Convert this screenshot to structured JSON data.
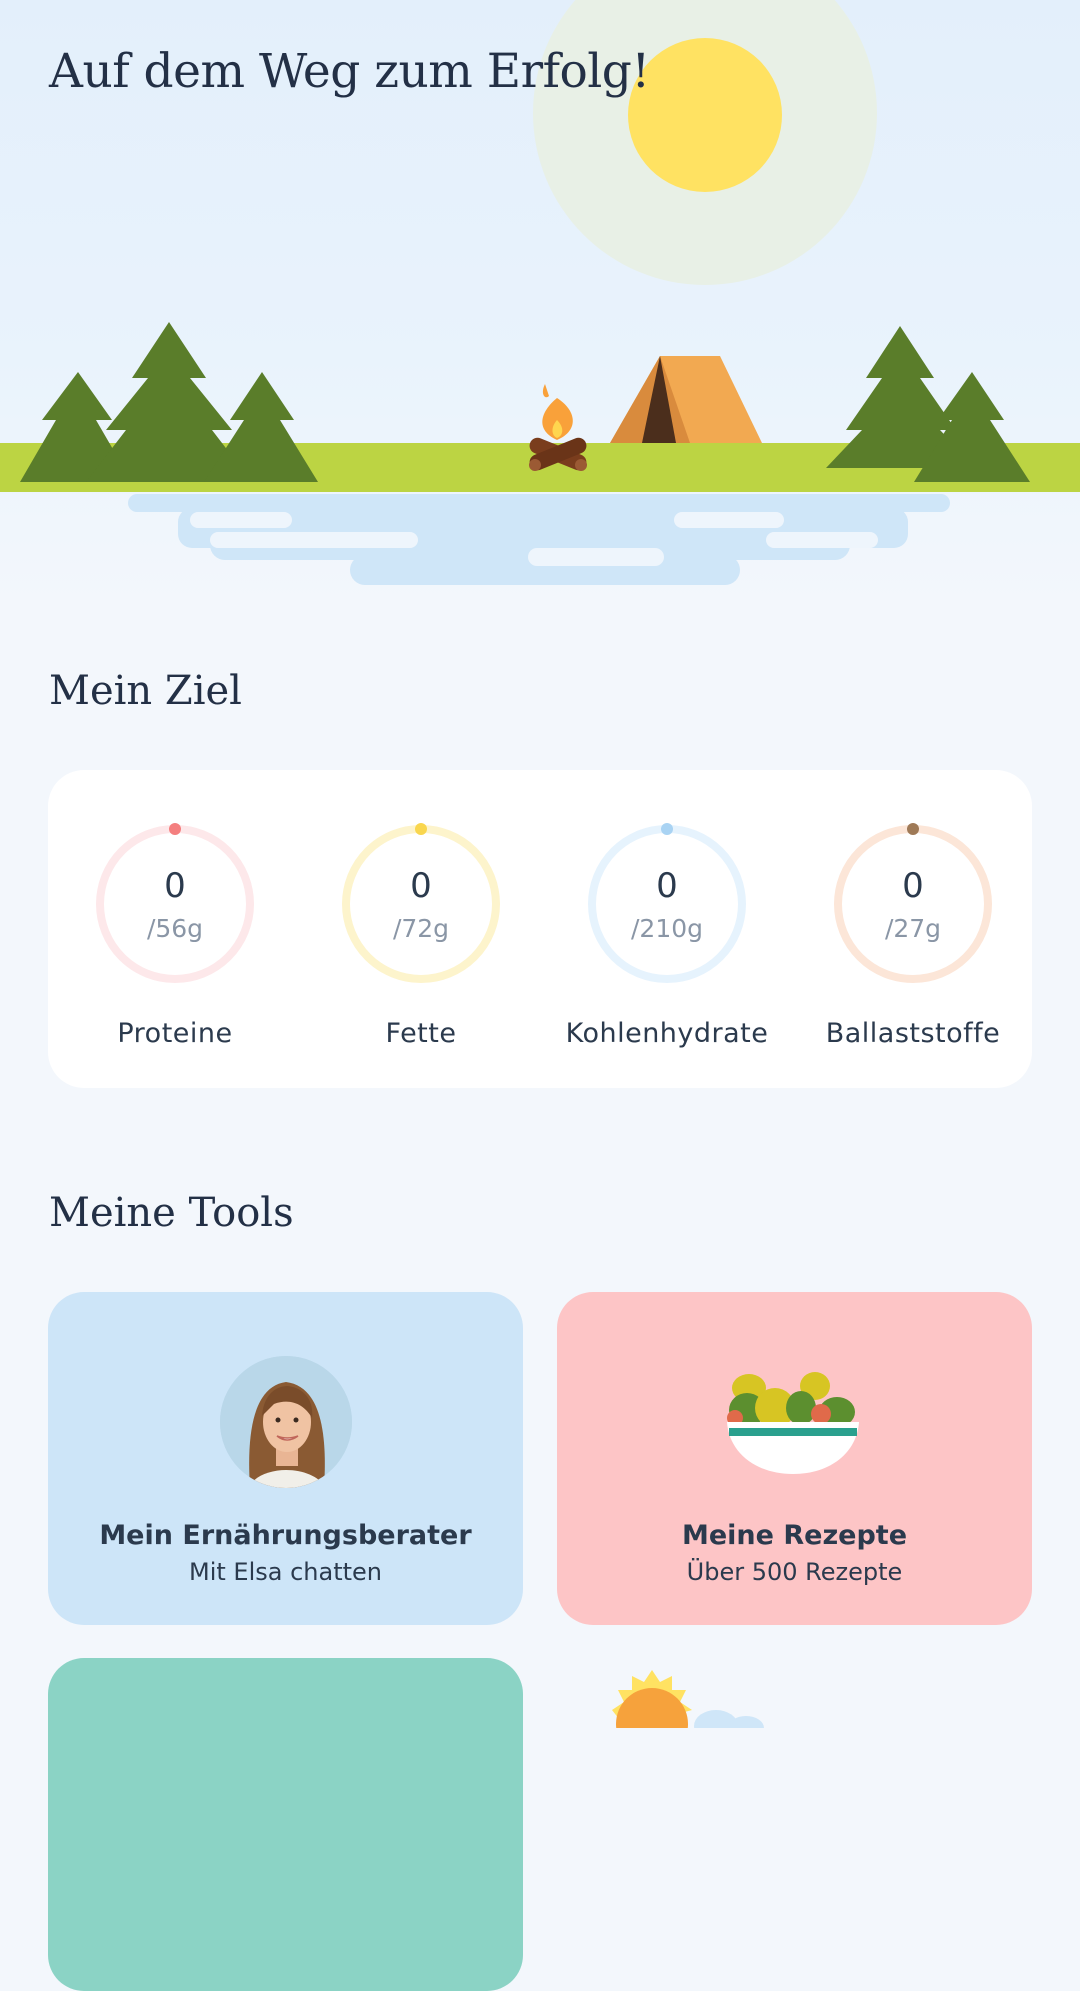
{
  "hero": {
    "title": "Auf dem Weg zum Erfolg!"
  },
  "goal": {
    "title": "Mein Ziel",
    "macros": [
      {
        "label": "Proteine",
        "value": "0",
        "goal": "/56g",
        "progress": 0,
        "color": "#f47f7f",
        "track": "#fde8ea"
      },
      {
        "label": "Fette",
        "value": "0",
        "goal": "/72g",
        "progress": 0,
        "color": "#f9d64e",
        "track": "#fdf4cc"
      },
      {
        "label": "Kohlenhydrate",
        "value": "0",
        "goal": "/210g",
        "progress": 0,
        "color": "#a9d3f3",
        "track": "#e6f3fd"
      },
      {
        "label": "Ballaststoffe",
        "value": "0",
        "goal": "/27g",
        "progress": 0,
        "color": "#9f7a57",
        "track": "#fce6d8"
      }
    ]
  },
  "tools": {
    "title": "Meine Tools",
    "cards": [
      {
        "title": "Mein Ernährungsberater",
        "subtitle": "Mit Elsa chatten",
        "color": "#cde5f8",
        "icon": "avatar"
      },
      {
        "title": "Meine Rezepte",
        "subtitle": "Über 500 Rezepte",
        "color": "#fdc5c6",
        "icon": "salad-bowl-icon"
      },
      {
        "color": "#8bd3c5",
        "icon": ""
      }
    ]
  }
}
